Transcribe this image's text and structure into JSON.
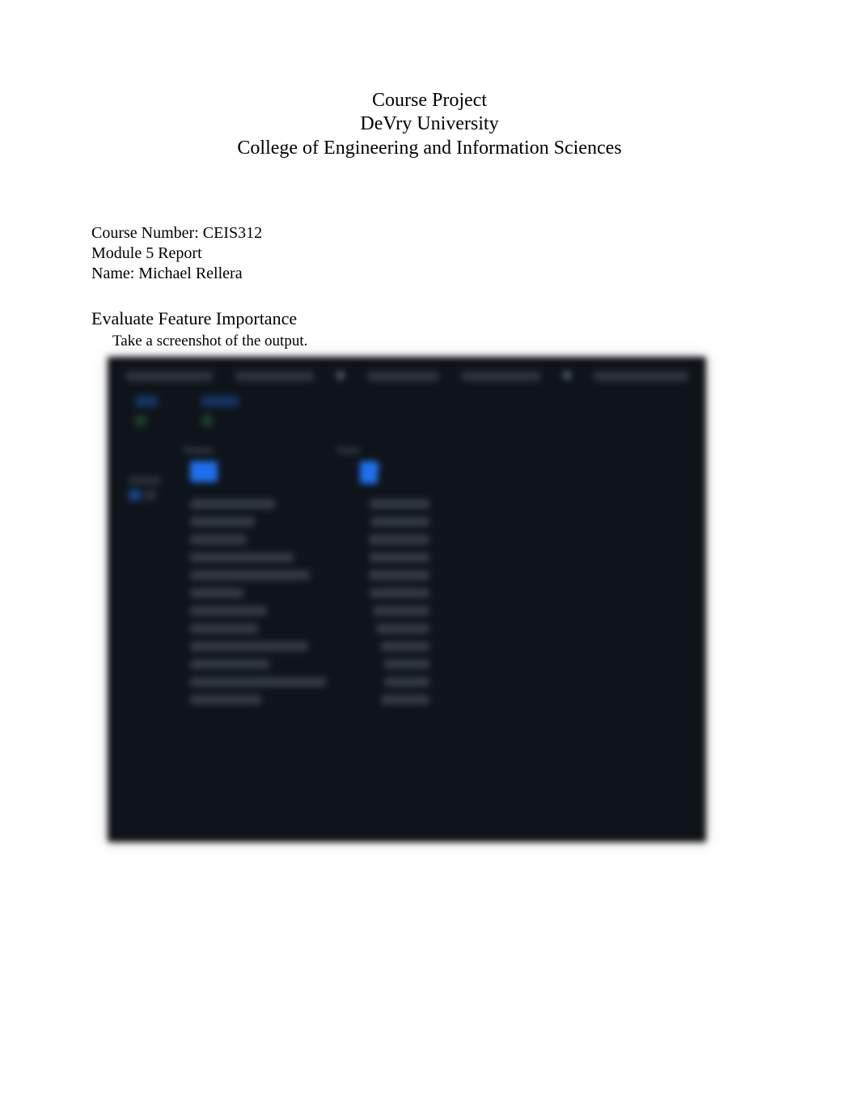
{
  "header": {
    "title": "Course Project",
    "university": "DeVry University",
    "college": "College of Engineering and Information Sciences"
  },
  "meta": {
    "course_label": "Course Number: CEIS312",
    "module_label": "Module 5 Report",
    "name_label": "Name: Michael Rellera"
  },
  "section": {
    "title": "Evaluate Feature Importance",
    "instruction": "Take a screenshot of the output."
  },
  "screenshot": {
    "headers": {
      "feature": "Feature",
      "score": "Score"
    }
  }
}
